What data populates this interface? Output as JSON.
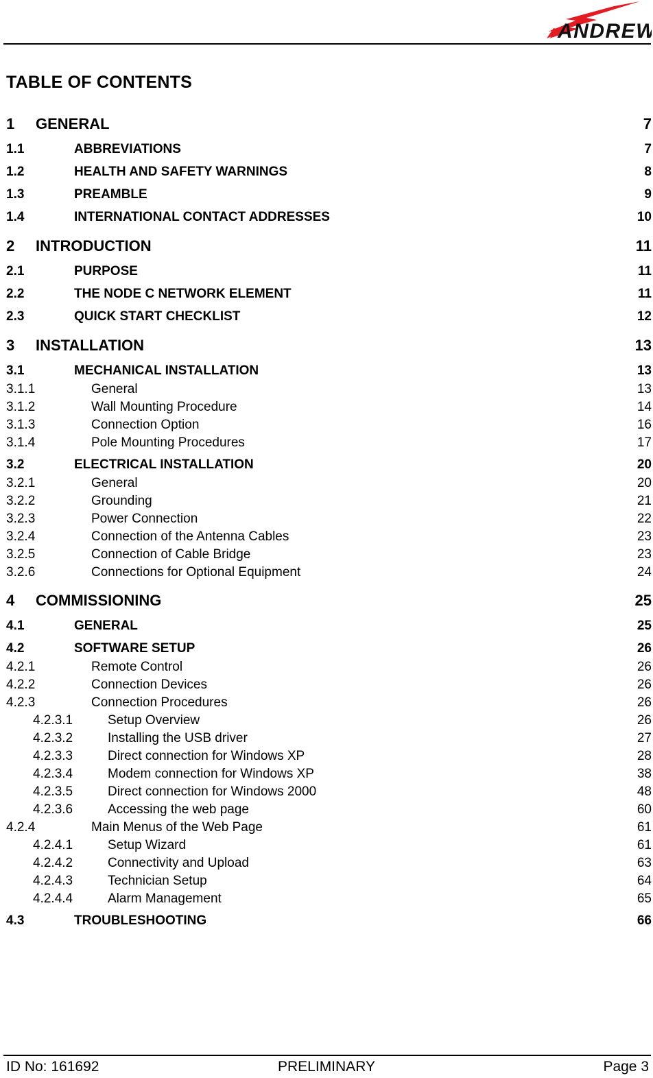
{
  "document": {
    "page_title": "TABLE OF CONTENTS",
    "logo": {
      "wordmark": "ANDREW.",
      "bolt_color": "#E31B23",
      "text_color": "#111111"
    }
  },
  "toc": {
    "entries": [
      {
        "level": 1,
        "number": "1",
        "title": "GENERAL",
        "page": "7"
      },
      {
        "level": 2,
        "number": "1.1",
        "title": "ABBREVIATIONS",
        "page": "7"
      },
      {
        "level": 2,
        "number": "1.2",
        "title": "HEALTH AND SAFETY WARNINGS",
        "page": "8"
      },
      {
        "level": 2,
        "number": "1.3",
        "title": "PREAMBLE",
        "page": "9"
      },
      {
        "level": 2,
        "number": "1.4",
        "title": "INTERNATIONAL CONTACT ADDRESSES",
        "page": "10"
      },
      {
        "level": 1,
        "number": "2",
        "title": "INTRODUCTION",
        "page": "11"
      },
      {
        "level": 2,
        "number": "2.1",
        "title": "PURPOSE",
        "page": "11"
      },
      {
        "level": 2,
        "number": "2.2",
        "title": "THE NODE C NETWORK ELEMENT",
        "page": "11"
      },
      {
        "level": 2,
        "number": "2.3",
        "title": "QUICK START CHECKLIST",
        "page": "12"
      },
      {
        "level": 1,
        "number": "3",
        "title": "INSTALLATION",
        "page": "13"
      },
      {
        "level": 2,
        "number": "3.1",
        "title": "MECHANICAL INSTALLATION",
        "page": "13"
      },
      {
        "level": 3,
        "number": "3.1.1",
        "title": "General",
        "page": "13"
      },
      {
        "level": 3,
        "number": "3.1.2",
        "title": "Wall Mounting Procedure",
        "page": "14"
      },
      {
        "level": 3,
        "number": "3.1.3",
        "title": "Connection Option",
        "page": "16"
      },
      {
        "level": 3,
        "number": "3.1.4",
        "title": "Pole Mounting Procedures",
        "page": "17"
      },
      {
        "level": 2,
        "number": "3.2",
        "title": "ELECTRICAL INSTALLATION",
        "page": "20"
      },
      {
        "level": 3,
        "number": "3.2.1",
        "title": "General",
        "page": "20"
      },
      {
        "level": 3,
        "number": "3.2.2",
        "title": "Grounding",
        "page": "21"
      },
      {
        "level": 3,
        "number": "3.2.3",
        "title": "Power Connection",
        "page": "22"
      },
      {
        "level": 3,
        "number": "3.2.4",
        "title": "Connection of the Antenna Cables",
        "page": "23"
      },
      {
        "level": 3,
        "number": "3.2.5",
        "title": "Connection of Cable Bridge",
        "page": "23"
      },
      {
        "level": 3,
        "number": "3.2.6",
        "title": "Connections for Optional Equipment",
        "page": "24"
      },
      {
        "level": 1,
        "number": "4",
        "title": "COMMISSIONING",
        "page": "25"
      },
      {
        "level": 2,
        "number": "4.1",
        "title": "GENERAL",
        "page": "25"
      },
      {
        "level": 2,
        "number": "4.2",
        "title": "SOFTWARE SETUP",
        "page": "26"
      },
      {
        "level": 3,
        "number": "4.2.1",
        "title": "Remote Control",
        "page": "26"
      },
      {
        "level": 3,
        "number": "4.2.2",
        "title": "Connection Devices",
        "page": "26"
      },
      {
        "level": 3,
        "number": "4.2.3",
        "title": "Connection Procedures",
        "page": "26"
      },
      {
        "level": 4,
        "number": "4.2.3.1",
        "title": "Setup Overview",
        "page": "26"
      },
      {
        "level": 4,
        "number": "4.2.3.2",
        "title": "Installing the USB driver",
        "page": "27"
      },
      {
        "level": 4,
        "number": "4.2.3.3",
        "title": "Direct connection for Windows XP",
        "page": "28"
      },
      {
        "level": 4,
        "number": "4.2.3.4",
        "title": "Modem connection for Windows XP",
        "page": "38"
      },
      {
        "level": 4,
        "number": "4.2.3.5",
        "title": "Direct connection for Windows 2000",
        "page": "48"
      },
      {
        "level": 4,
        "number": "4.2.3.6",
        "title": "Accessing the web page",
        "page": "60"
      },
      {
        "level": 3,
        "number": "4.2.4",
        "title": "Main Menus of the Web Page",
        "page": "61"
      },
      {
        "level": 4,
        "number": "4.2.4.1",
        "title": "Setup Wizard",
        "page": "61"
      },
      {
        "level": 4,
        "number": "4.2.4.2",
        "title": "Connectivity and Upload",
        "page": "63"
      },
      {
        "level": 4,
        "number": "4.2.4.3",
        "title": "Technician Setup",
        "page": "64"
      },
      {
        "level": 4,
        "number": "4.2.4.4",
        "title": "Alarm Management",
        "page": "65"
      },
      {
        "level": 2,
        "number": "4.3",
        "title": "TROUBLESHOOTING",
        "page": "66"
      }
    ]
  },
  "footer": {
    "id_label": "ID No: 161692",
    "status": "PRELIMINARY",
    "page_label": "Page 3"
  }
}
